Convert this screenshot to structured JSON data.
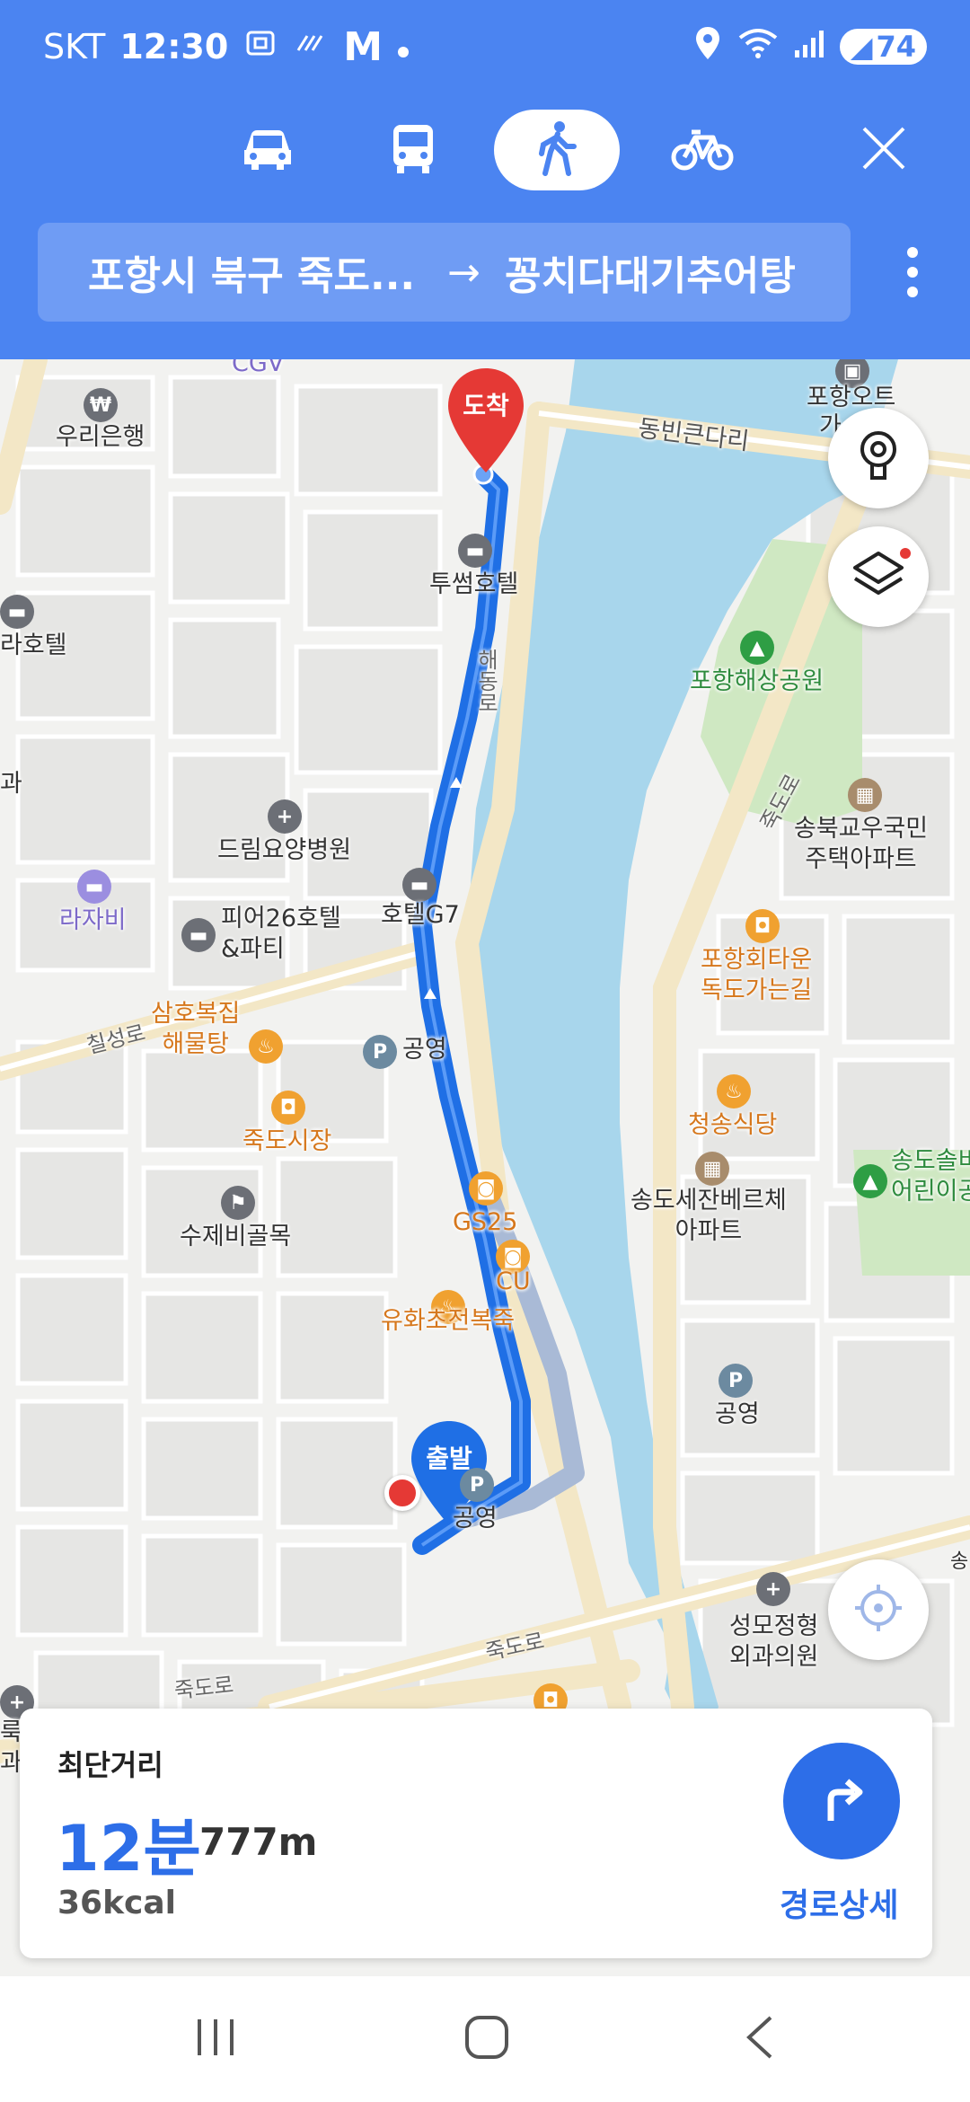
{
  "status_bar": {
    "carrier": "SKT",
    "time": "12:30",
    "battery": "74"
  },
  "header": {
    "modes": [
      {
        "name": "car",
        "icon": "car-icon"
      },
      {
        "name": "bus",
        "icon": "bus-icon"
      },
      {
        "name": "walk",
        "icon": "walking-icon",
        "active": true
      },
      {
        "name": "bike",
        "icon": "bicycle-icon"
      }
    ],
    "origin": "포항시 북구 죽도...",
    "arrow": "→",
    "destination": "꽁치다대기추어탕"
  },
  "map": {
    "pins": {
      "arrival": "도착",
      "departure": "출발"
    },
    "labels": {
      "cgv": "CGV",
      "woori_bank": "우리은행",
      "raho_hotel": "라호텔",
      "gwa_left": "과",
      "pohang_tower": "포항오트",
      "tower_cut": "가",
      "dongbin_bridge": "동빈큰다리",
      "tusum_hotel": "투썸호텔",
      "haedong_ro": "해동로",
      "pohang_marine_park": "포항해상공원",
      "dream_hospital": "드림요양병원",
      "songbuk_apt": "송북교우국민\n주택아파트",
      "jukdo_ro_vert": "죽도로",
      "rajabi": "라자비",
      "pier26_hotel": "피어26호텔\n&파티",
      "hotel_g7": "호텔G7",
      "pohang_hoe_town": "포항회타운\n독도가는길",
      "chilseong_ro": "칠성로",
      "samho_bokjip": "삼호복집\n해물탕",
      "parking_public_1": "공영",
      "jukdo_market": "죽도시장",
      "cheongsong_restaurant": "청송식당",
      "songdo_cut": "송도솔비\n어린이공",
      "gs25": "GS25",
      "songdo_apt": "송도세잔베르체\n아파트",
      "sujebi_alley": "수제비골목",
      "cu": "CU",
      "parking_public_2": "공영",
      "yuhwa_porridge": "유화초전복죽",
      "parking_public_3": "공영",
      "jukdo_ro_1": "죽도로",
      "jukdo_ro_2": "죽도로",
      "seongmo_clinic": "성모정형\n외과의원",
      "left_edge_1": "룩",
      "left_edge_2": "과",
      "right_edge_so": "송"
    }
  },
  "summary": {
    "label": "최단거리",
    "time": "12분",
    "distance": "777m",
    "calories": "36kcal",
    "detail_button": "경로상세"
  },
  "colors": {
    "header": "#4b84f1",
    "route": "#1f6fe5",
    "arrival_pin": "#e53935",
    "accent": "#2d6ee8",
    "water": "#a8d6ec",
    "park": "#cfe8c2"
  }
}
